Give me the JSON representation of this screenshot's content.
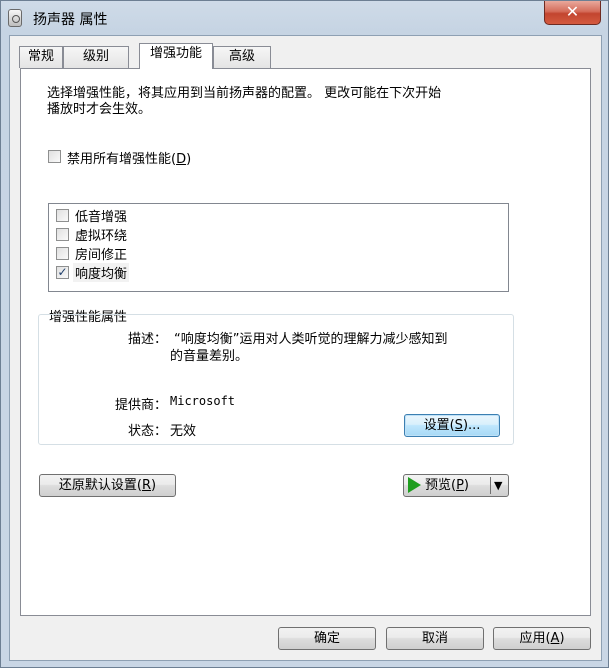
{
  "window": {
    "title": "扬声器 属性",
    "close_label": "✕"
  },
  "tabs": [
    {
      "label": "常规"
    },
    {
      "label": "级别"
    },
    {
      "label": "增强功能",
      "active": true
    },
    {
      "label": "高级"
    }
  ],
  "enhancements": {
    "description_line1": "选择增强性能，将其应用到当前扬声器的配置。   更改可能在下次开始",
    "description_line2": "播放时才会生效。",
    "disable_all": {
      "label_prefix": "禁用所有增强性能(",
      "accel": "D",
      "label_suffix": ")",
      "checked": false
    },
    "items": [
      {
        "label": "低音增强",
        "checked": false
      },
      {
        "label": "虚拟环绕",
        "checked": false
      },
      {
        "label": "房间修正",
        "checked": false
      },
      {
        "label": "响度均衡",
        "checked": true,
        "check_glyph": "✓"
      }
    ]
  },
  "properties": {
    "group_title": "增强性能属性",
    "description_label": "描述：",
    "description_line1": "“响度均衡”运用对人类听觉的理解力减少感知到",
    "description_line2": "的音量差别。",
    "provider_label": "提供商：",
    "provider_value": "Microsoft",
    "status_label": "状态：",
    "status_value": "无效",
    "settings_button": {
      "prefix": "设置(",
      "accel": "S",
      "suffix": ")..."
    }
  },
  "actions": {
    "restore_defaults": {
      "prefix": "还原默认设置(",
      "accel": "R",
      "suffix": ")"
    },
    "preview": {
      "prefix": "预览(",
      "accel": "P",
      "suffix": ")",
      "dropdown_glyph": "▼"
    }
  },
  "footer": {
    "ok": "确定",
    "cancel": "取消",
    "apply": {
      "prefix": "应用(",
      "accel": "A",
      "suffix": ")"
    }
  }
}
